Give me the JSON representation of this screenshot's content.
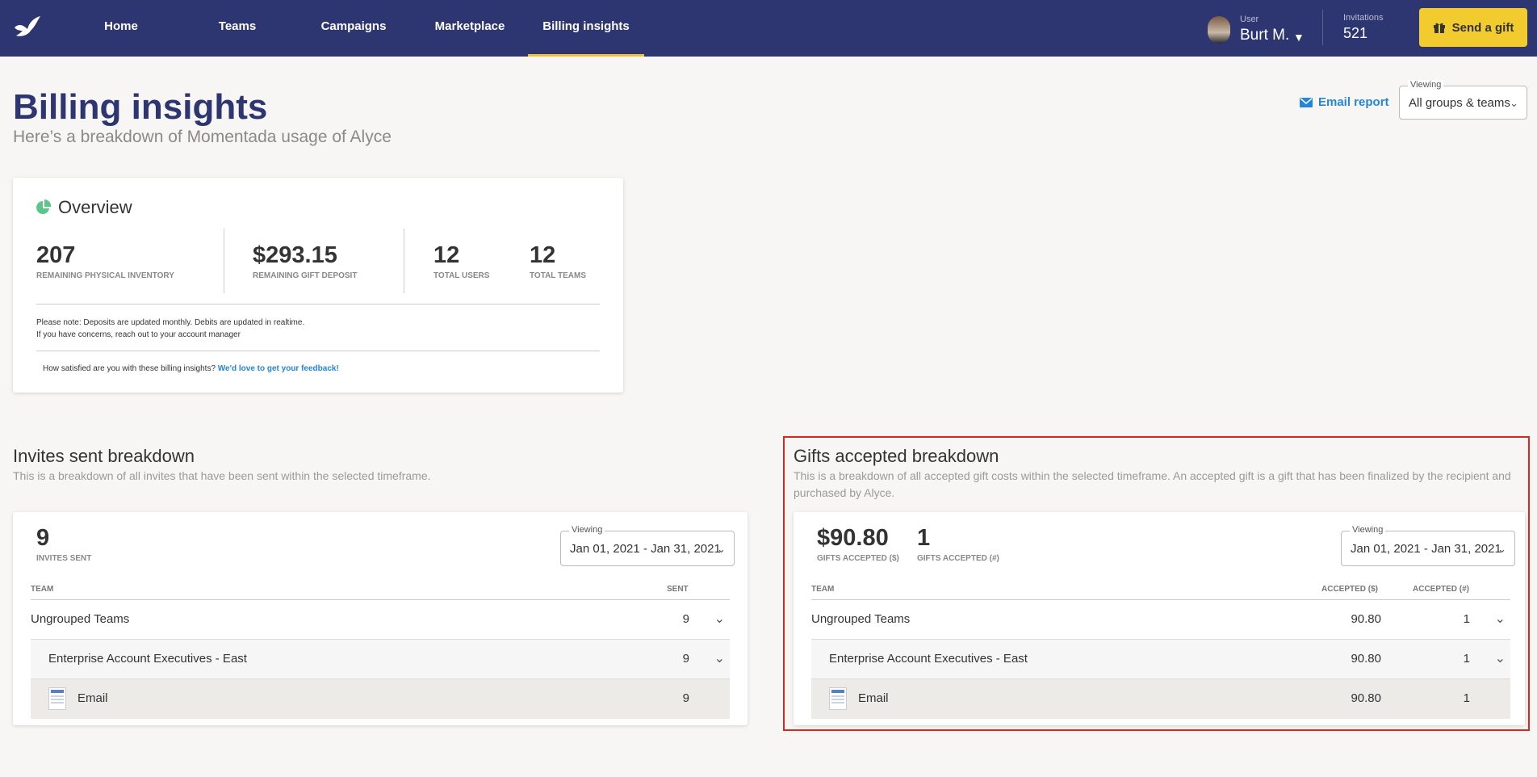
{
  "nav": {
    "tabs": [
      {
        "label": "Home"
      },
      {
        "label": "Teams"
      },
      {
        "label": "Campaigns"
      },
      {
        "label": "Marketplace"
      },
      {
        "label": "Billing insights"
      }
    ],
    "user_caption": "User",
    "user_name": "Burt M.",
    "invitations_caption": "Invitations",
    "invitations_count": "521",
    "send_gift_label": "Send a gift"
  },
  "page": {
    "title": "Billing insights",
    "subtitle": "Here’s a breakdown of Momentada usage of Alyce",
    "email_report_label": "Email report",
    "viewing_legend": "Viewing",
    "viewing_value": "All groups & teams"
  },
  "overview": {
    "title": "Overview",
    "stats": [
      {
        "value": "207",
        "label": "REMAINING PHYSICAL INVENTORY"
      },
      {
        "value": "$293.15",
        "label": "REMAINING GIFT DEPOSIT"
      },
      {
        "value": "12",
        "label": "TOTAL USERS"
      },
      {
        "value": "12",
        "label": "TOTAL TEAMS"
      }
    ],
    "note_line1": "Please note: Deposits are updated monthly. Debits are updated in realtime.",
    "note_line2": "If you have concerns, reach out to your account manager",
    "feedback_text": "How satisfied are you with these billing insights?",
    "feedback_link": "We'd love to get your feedback!"
  },
  "invites": {
    "title": "Invites sent breakdown",
    "description": "This is a breakdown of all invites that have been sent within the selected timeframe.",
    "stat_value": "9",
    "stat_label": "INVITES SENT",
    "viewing_legend": "Viewing",
    "date_range": "Jan 01, 2021 - Jan 31, 2021",
    "columns": {
      "team": "TEAM",
      "sent": "SENT"
    },
    "rows": [
      {
        "team": "Ungrouped Teams",
        "sent": "9"
      },
      {
        "team": "Enterprise Account Executives - East",
        "sent": "9"
      },
      {
        "team": "Email",
        "sent": "9"
      }
    ]
  },
  "gifts": {
    "title": "Gifts accepted breakdown",
    "description": "This is a breakdown of all accepted gift costs within the selected timeframe. An accepted gift is a gift that has been finalized by the recipient and purchased by Alyce.",
    "stat1_value": "$90.80",
    "stat1_label": "GIFTS ACCEPTED ($)",
    "stat2_value": "1",
    "stat2_label": "GIFTS ACCEPTED (#)",
    "viewing_legend": "Viewing",
    "date_range": "Jan 01, 2021 - Jan 31, 2021",
    "columns": {
      "team": "TEAM",
      "accepted_usd": "ACCEPTED ($)",
      "accepted_count": "ACCEPTED (#)"
    },
    "rows": [
      {
        "team": "Ungrouped Teams",
        "accepted_usd": "90.80",
        "accepted_count": "1"
      },
      {
        "team": "Enterprise Account Executives - East",
        "accepted_usd": "90.80",
        "accepted_count": "1"
      },
      {
        "team": "Email",
        "accepted_usd": "90.80",
        "accepted_count": "1"
      }
    ]
  },
  "colors": {
    "nav_bg": "#2e3671",
    "accent_yellow": "#f2cb2e",
    "link_blue": "#2486d8",
    "overview_icon_green": "#5cc68a",
    "highlight_red": "#d9281f"
  }
}
